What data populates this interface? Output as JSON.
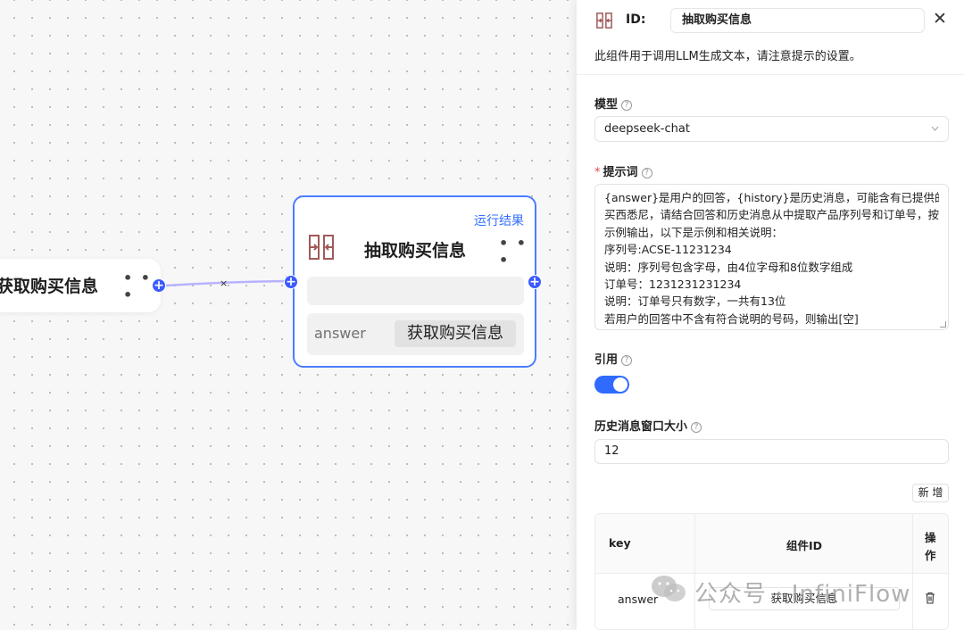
{
  "canvas": {
    "left_node": {
      "title": "获取购买信息",
      "more": "• • •"
    },
    "edge": {
      "remove_symbol": "×"
    },
    "main_node": {
      "run_result": "运行结果",
      "title": "抽取购买信息",
      "more": "• • •",
      "param": {
        "key": "answer",
        "value": "获取购买信息"
      }
    },
    "handle_symbol": "+"
  },
  "panel": {
    "id_label": "ID:",
    "id_value": "抽取购买信息",
    "close": "✕",
    "description": "此组件用于调用LLM生成文本，请注意提示的设置。",
    "model": {
      "label": "模型",
      "value": "deepseek-chat"
    },
    "prompt": {
      "required_mark": "*",
      "label": "提示词",
      "lines": [
        "{answer}是用户的回答，{history}是历史消息，可能含有已提供的购",
        "买西悉尼，请结合回答和历史消息从中提取产品序列号和订单号，按",
        "示例输出，以下是示例和相关说明：",
        "序列号:ACSE-11231234",
        "说明：序列号包含字母，由4位字母和8位数字组成",
        "订单号：1231231231234",
        "说明：订单号只有数字，一共有13位",
        "若用户的回答中不含有符合说明的号码，则输出[空]"
      ]
    },
    "quote": {
      "label": "引用",
      "enabled": true
    },
    "history_window": {
      "label": "历史消息窗口大小",
      "value": "12"
    },
    "add_button": "新 增",
    "table": {
      "headers": {
        "key": "key",
        "component_id": "组件ID",
        "action": "操\n作"
      },
      "action_line1": "操",
      "action_line2": "作",
      "rows": [
        {
          "key": "answer",
          "component_id": "获取购买信息"
        }
      ]
    },
    "help_symbol": "?"
  },
  "watermark": {
    "text": "公众号 · InfiniFlow"
  },
  "colors": {
    "accent": "#3b5bff",
    "toggle": "#2f6bff",
    "border_selected": "#4a7dff",
    "link": "#3470ff"
  }
}
